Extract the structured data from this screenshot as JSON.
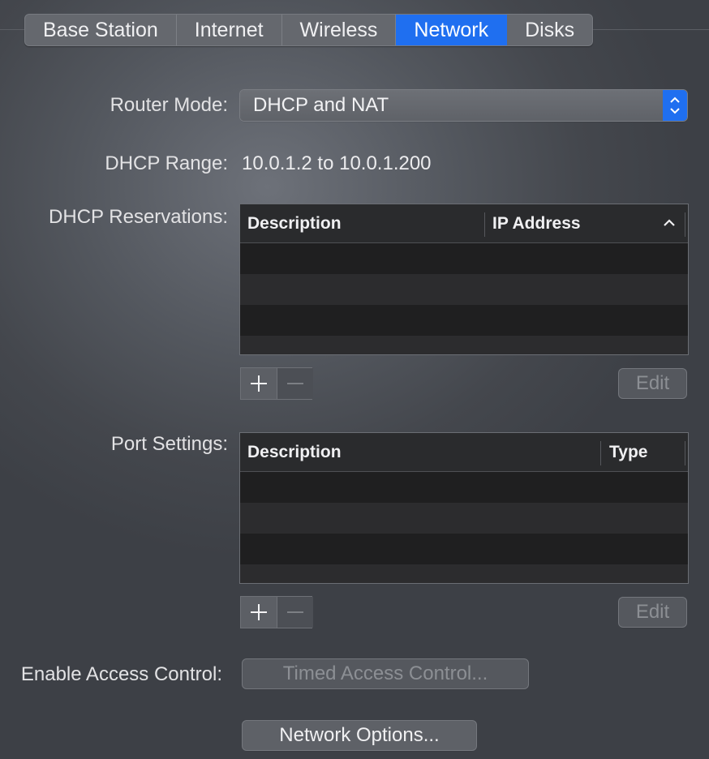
{
  "tabs": [
    {
      "label": "Base Station",
      "active": false
    },
    {
      "label": "Internet",
      "active": false
    },
    {
      "label": "Wireless",
      "active": false
    },
    {
      "label": "Network",
      "active": true
    },
    {
      "label": "Disks",
      "active": false
    }
  ],
  "router_mode": {
    "label": "Router Mode:",
    "value": "DHCP and NAT"
  },
  "dhcp_range": {
    "label": "DHCP Range:",
    "value": "10.0.1.2 to 10.0.1.200"
  },
  "dhcp_reservations": {
    "label": "DHCP Reservations:",
    "columns": [
      "Description",
      "IP Address"
    ],
    "sort_icon": "chevron-up-icon",
    "rows": [],
    "add_icon": "plus-icon",
    "remove_icon": "minus-icon",
    "edit_label": "Edit"
  },
  "port_settings": {
    "label": "Port Settings:",
    "columns": [
      "Description",
      "Type"
    ],
    "rows": [],
    "add_icon": "plus-icon",
    "remove_icon": "minus-icon",
    "edit_label": "Edit"
  },
  "access_control": {
    "label": "Enable Access Control:",
    "button_label": "Timed Access Control..."
  },
  "network_options": {
    "button_label": "Network Options..."
  },
  "colors": {
    "accent": "#1f6ff0"
  }
}
